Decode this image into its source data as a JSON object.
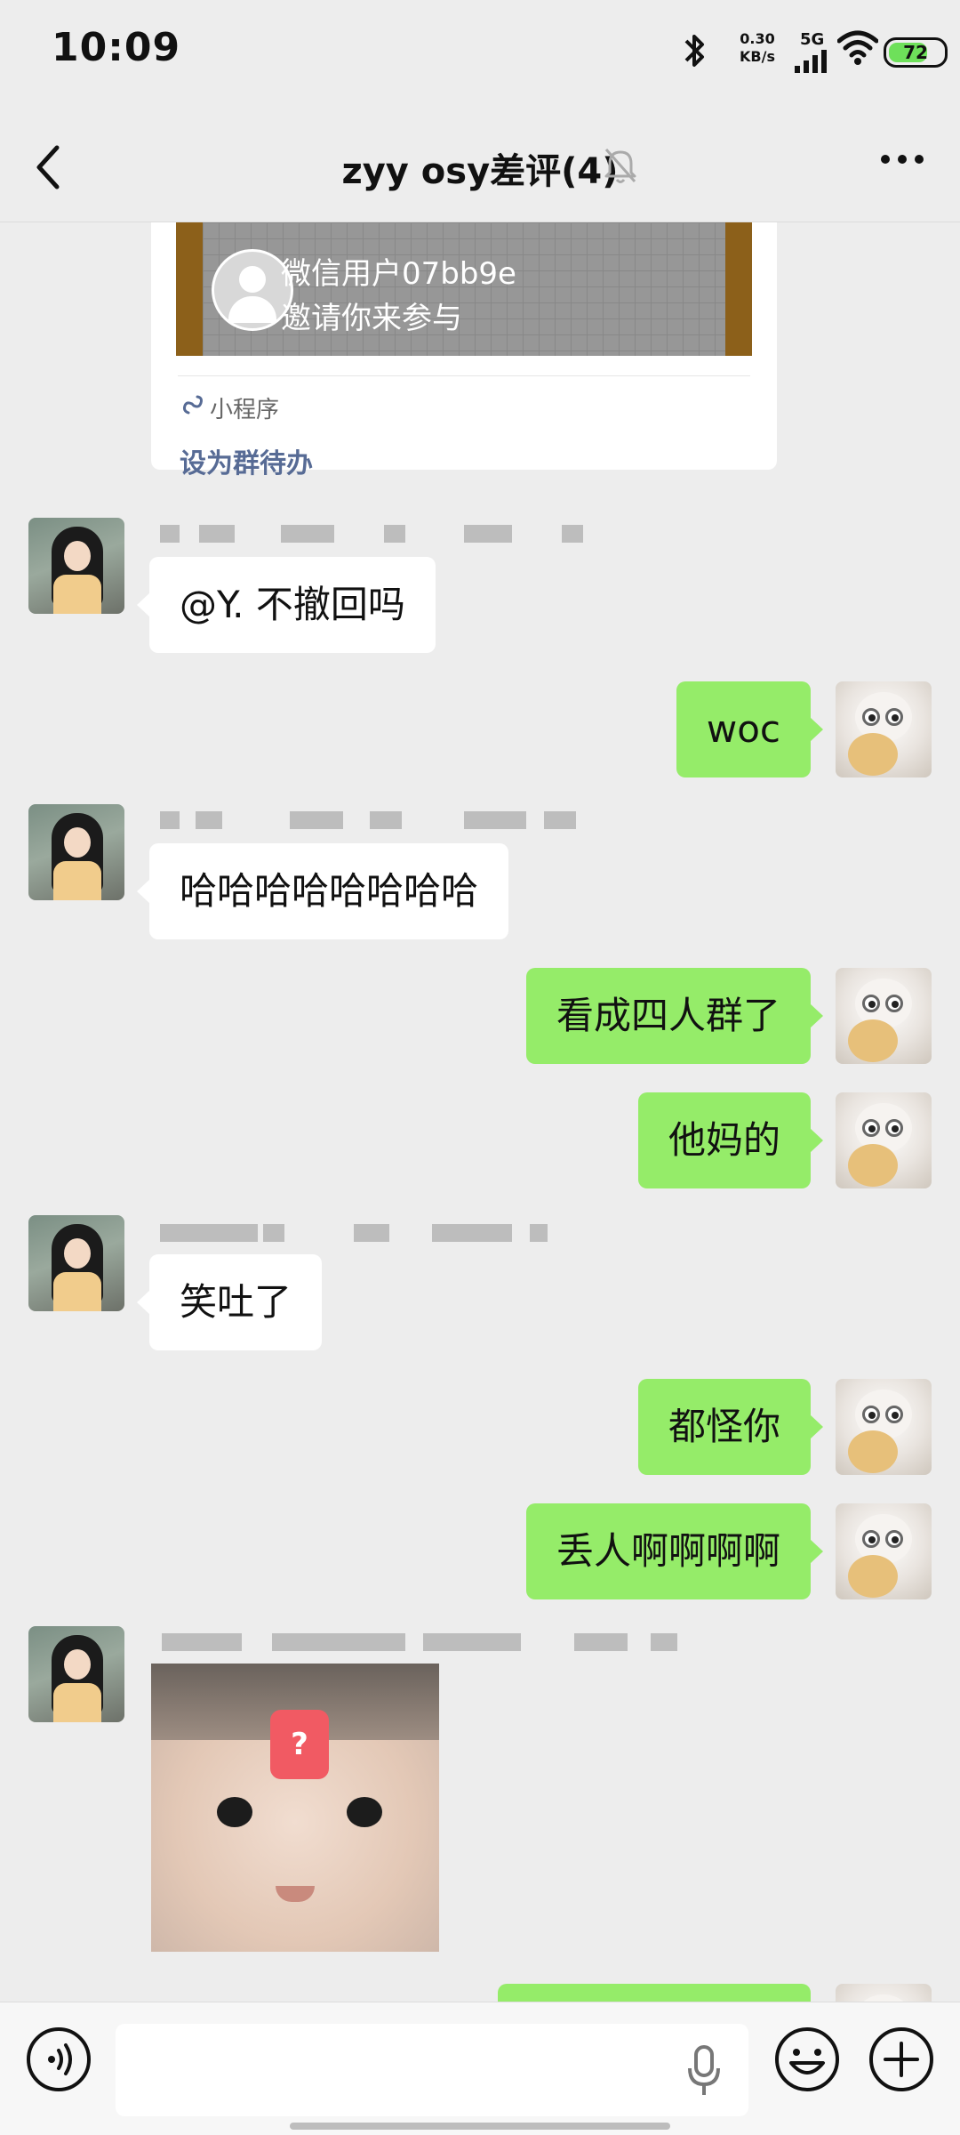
{
  "status_bar": {
    "time": "10:09",
    "net_speed_value": "0.30",
    "net_speed_unit": "KB/s",
    "signal_label": "5G",
    "battery": "72",
    "battery_level": 0.72
  },
  "header": {
    "title": "zyy osy差评(4)"
  },
  "mini_program": {
    "inviter": "微信用户07bb9e",
    "invite_text": "邀请你来参与",
    "label": "小程序",
    "action": "设为群待办"
  },
  "messages": [
    {
      "side": "left",
      "text": "@Y. 不撤回吗"
    },
    {
      "side": "right",
      "text": "woc"
    },
    {
      "side": "left",
      "text": "哈哈哈哈哈哈哈哈"
    },
    {
      "side": "right",
      "text": "看成四人群了"
    },
    {
      "side": "right",
      "text": "他妈的"
    },
    {
      "side": "left",
      "text": "笑吐了"
    },
    {
      "side": "right",
      "text": "都怪你"
    },
    {
      "side": "right",
      "text": "丢人啊啊啊啊"
    },
    {
      "side": "left",
      "type": "image",
      "badge": "?"
    }
  ],
  "input": {
    "value": ""
  },
  "colors": {
    "background": "#ededed",
    "self_bubble": "#95ec69",
    "other_bubble": "#ffffff",
    "link": "#576b95"
  },
  "icons": [
    "bluetooth-icon",
    "signal-icon",
    "wifi-icon",
    "back-icon",
    "mute-bell-icon",
    "more-icon",
    "voice-icon",
    "mic-icon",
    "emoji-icon",
    "plus-icon",
    "mini-program-link-icon"
  ]
}
